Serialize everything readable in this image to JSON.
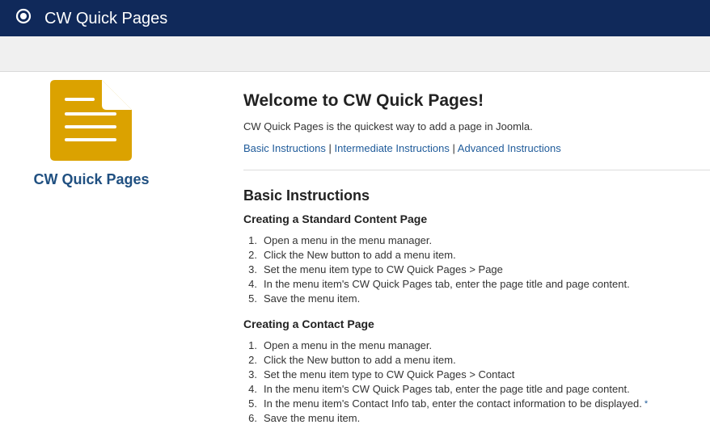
{
  "header": {
    "app_title": "CW Quick Pages",
    "icon": "radio-target-icon",
    "colors": {
      "bar": "#10295a",
      "text": "#ffffff"
    }
  },
  "sidebar": {
    "icon": "document-icon",
    "icon_color": "#dba200",
    "title": "CW Quick Pages"
  },
  "main": {
    "welcome_title": "Welcome to CW Quick Pages!",
    "intro": "CW Quick Pages is the quickest way to add a page in Joomla.",
    "links": {
      "basic": "Basic Instructions",
      "intermediate": "Intermediate Instructions",
      "advanced": "Advanced Instructions",
      "separator": "|"
    },
    "section_title": "Basic Instructions",
    "standard": {
      "title": "Creating a Standard Content Page",
      "steps": [
        {
          "n": "1.",
          "text": "Open a menu in the menu manager."
        },
        {
          "n": "2.",
          "text": "Click the New button to add a menu item."
        },
        {
          "n": "3.",
          "text": "Set the menu item type to CW Quick Pages > Page"
        },
        {
          "n": "4.",
          "text": "In the menu item's CW Quick Pages tab, enter the page title and page content."
        },
        {
          "n": "5.",
          "text": "Save the menu item."
        }
      ]
    },
    "contact": {
      "title": "Creating a Contact Page",
      "steps": [
        {
          "n": "1.",
          "text": "Open a menu in the menu manager."
        },
        {
          "n": "2.",
          "text": "Click the New button to add a menu item."
        },
        {
          "n": "3.",
          "text": "Set the menu item type to CW Quick Pages > Contact"
        },
        {
          "n": "4.",
          "text": "In the menu item's CW Quick Pages tab, enter the page title and page content."
        },
        {
          "n": "5.",
          "text": "In the menu item's Contact Info tab, enter the contact information to be displayed."
        },
        {
          "n": "6.",
          "text": "Save the menu item."
        }
      ],
      "note_marker": "*"
    }
  }
}
